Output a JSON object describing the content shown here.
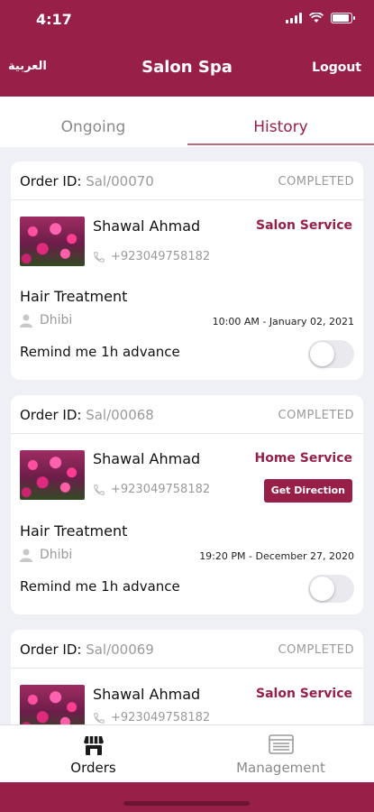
{
  "status_bar": {
    "time": "4:17"
  },
  "header": {
    "language_label": "العربية",
    "title": "Salon Spa",
    "logout_label": "Logout"
  },
  "tabs": [
    {
      "label": "Ongoing",
      "active": false
    },
    {
      "label": "History",
      "active": true
    }
  ],
  "orders": [
    {
      "id_label": "Order ID: ",
      "id_value": "Sal/00070",
      "status": "COMPLETED",
      "customer": "Shawal Ahmad",
      "service_type": "Salon Service",
      "phone": "+923049758182",
      "service": "Hair Treatment",
      "staff": "Dhibi",
      "datetime": "10:00 AM - January 02, 2021",
      "remind_label": "Remind me 1h advance",
      "remind_on": false
    },
    {
      "id_label": "Order ID: ",
      "id_value": "Sal/00068",
      "status": "COMPLETED",
      "customer": "Shawal Ahmad",
      "service_type": "Home Service",
      "phone": "+923049758182",
      "direction_button": "Get Direction",
      "service": "Hair Treatment",
      "staff": "Dhibi",
      "datetime": "19:20 PM - December 27, 2020",
      "remind_label": "Remind me 1h advance",
      "remind_on": false
    },
    {
      "id_label": "Order ID: ",
      "id_value": "Sal/00069",
      "status": "COMPLETED",
      "customer": "Shawal Ahmad",
      "service_type": "Salon Service",
      "phone": "+923049758182"
    }
  ],
  "bottom_nav": [
    {
      "label": "Orders",
      "icon": "store-icon",
      "active": true
    },
    {
      "label": "Management",
      "icon": "management-icon",
      "active": false
    }
  ],
  "colors": {
    "brand": "#981f48",
    "muted": "#9a9a9a",
    "background": "#eef0f5"
  }
}
